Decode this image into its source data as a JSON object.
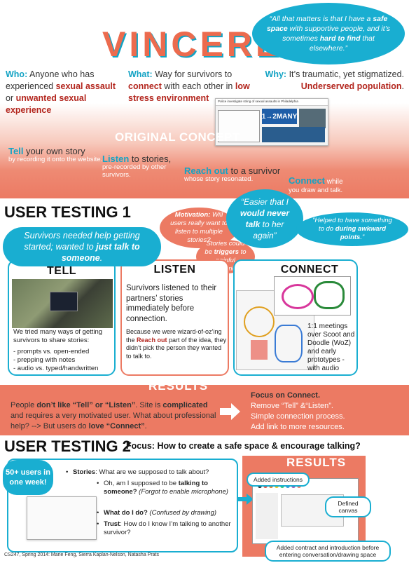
{
  "title": "VINCERE",
  "quote_top": {
    "parts": [
      "“All that matters is that I have a ",
      "safe space",
      " with supportive people, and it’s sometimes ",
      "hard to find",
      " that elsewhere.”"
    ]
  },
  "who": {
    "label": "Who:",
    "text1": " Anyone who has experienced ",
    "hl1": "sexual assault",
    "text2": " or ",
    "hl2": "unwanted sexual experience"
  },
  "what": {
    "label": "What:",
    "text1": " Way for survivors to ",
    "hl1": "connect",
    "text2": " with each other in ",
    "hl2": "low stress environment"
  },
  "why": {
    "label": "Why:",
    "text1": " It’s traumatic, yet stigmatized. ",
    "hl1": "Underserved population",
    "text2": "."
  },
  "site_shot": {
    "header": "Police investigate string of sexual assaults in Philadelphia",
    "logo": "1→2MANY"
  },
  "original_concept": {
    "heading": "ORIGINAL CONCEPT",
    "tell": {
      "lead": "Tell",
      "rest": " your own story",
      "sub": "by recording it onto the website."
    },
    "listen": {
      "lead": "Listen",
      "rest": " to stories,",
      "sub": "pre-recorded by other survivors."
    },
    "reach": {
      "lead": "Reach out",
      "rest": " to a survivor",
      "sub": "whose story resonated."
    },
    "connect": {
      "lead": "Connect",
      "rest": " while",
      "sub": "you draw and talk."
    }
  },
  "ut1": {
    "heading": "USER TESTING 1",
    "motivation": {
      "lead": "Motivation:",
      "rest": " Will users really want to listen to multiple stories?"
    },
    "triggers": {
      "pre": "Stories could be ",
      "hl": "triggers",
      "post": " to painful memories."
    },
    "quote_never": {
      "pre": "“Easier that I ",
      "hl": "would never talk",
      "post": " to her again”"
    },
    "quote_helped": {
      "pre": "“Helped to have something to do ",
      "hl": "during awkward points",
      "post": ".”"
    },
    "needed_help": {
      "pre": "Survivors needed help getting started; wanted to ",
      "hl": "just talk to someone",
      "post": "."
    },
    "tell": {
      "title": "TELL",
      "intro": "We tried many ways of getting survivors to share stories:",
      "items": [
        "- prompts vs. open-ended",
        "- prepping with notes",
        "- audio vs. typed/handwritten"
      ]
    },
    "listen": {
      "title": "LISTEN",
      "main": "Survivors listened to their partners’ stories immediately before connection.",
      "note_pre": "Because we were wizard-of-oz’ing the ",
      "note_hl": "Reach out",
      "note_post": " part of the idea, they didn’t pick the person they wanted to talk to."
    },
    "connect": {
      "title": "CONNECT",
      "body": "1:1 meetings over Scoot and Doodle (WoZ) and early prototypes - with audio"
    }
  },
  "results1": {
    "heading": "RESULTS",
    "left": {
      "p1": "People ",
      "b1": "don’t like “Tell” or “Listen”",
      "p2": ". Site is ",
      "b2": "complicated",
      "p3": " and requires a very motivated user. What about professional help? --> But users do ",
      "b3": "love “Connect”",
      "p4": "."
    },
    "right": {
      "heading": "Focus on Connect.",
      "lines": [
        "Remove “Tell” &“Listen”.",
        "Simple connection process.",
        "Add link to more resources."
      ]
    }
  },
  "ut2": {
    "heading": "USER TESTING 2",
    "focus": "Focus: How to create a safe space & encourage talking?",
    "users": "50+ users in one week!",
    "items": [
      {
        "lead": "Stories",
        "rest": ": What are we supposed to talk about?"
      },
      {
        "pre": "Oh, am I supposed to be ",
        "b": "talking to someone?",
        "it": " (Forgot to enable microphone)"
      },
      {
        "lead": "What do I do?",
        "it": " (Confused by drawing)"
      },
      {
        "lead": "Trust",
        "rest": ": How do I know I’m talking to another survivor?"
      }
    ]
  },
  "results2": {
    "heading": "RESULTS",
    "tag_instructions": "Added instructions",
    "tag_canvas": "Defined canvas",
    "tag_contract": "Added contract and introduction before entering conversation/drawing space"
  },
  "footer": "CS247, Spring 2014: Marie Feng, Sierra Kaplan-Nelson, Natasha Prats",
  "colors": {
    "salmon": "#ec7a63",
    "teal": "#19aed1",
    "accent_red": "#b3261e"
  }
}
